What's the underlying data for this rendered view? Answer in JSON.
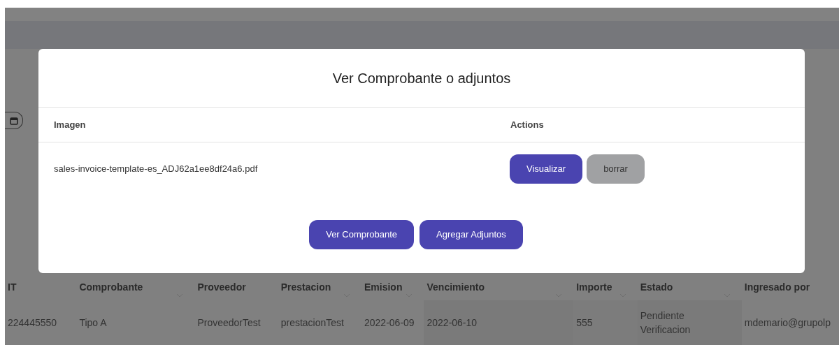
{
  "background_table": {
    "columns": [
      "IT",
      "Comprobante",
      "Proveedor",
      "Prestacion",
      "Emision",
      "Vencimiento",
      "Importe",
      "Estado",
      "Ingresado por"
    ],
    "rows": [
      [
        "224445550",
        "Tipo A",
        "ProveedorTest",
        "prestacionTest",
        "2022-06-09",
        "2022-06-10",
        "555",
        "Pendiente Verificacion",
        "mdemario@grupolp"
      ]
    ]
  },
  "modal": {
    "title": "Ver Comprobante o adjuntos",
    "columns": [
      "Imagen",
      "Actions"
    ],
    "attachments": [
      {
        "file": "sales-invoice-template-es_ADJ62a1ee8df24a6.pdf",
        "actions": [
          {
            "label": "Visualizar",
            "kind": "primary"
          },
          {
            "label": "borrar",
            "kind": "secondary"
          }
        ]
      }
    ],
    "buttons": [
      {
        "label": "Ver Comprobante",
        "kind": "primary"
      },
      {
        "label": "Agregar Adjuntos",
        "kind": "primary"
      }
    ]
  }
}
